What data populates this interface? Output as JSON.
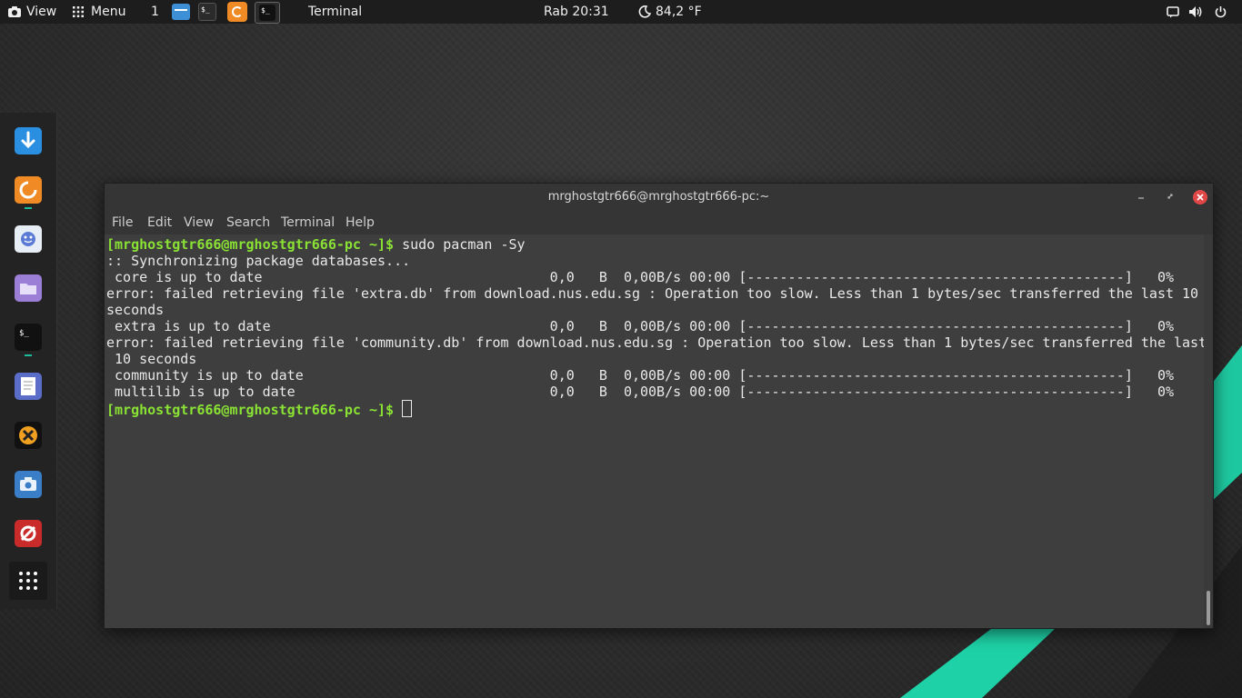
{
  "top_panel": {
    "view_label": "View",
    "menu_label": "Menu",
    "workspace": "1",
    "active_app": "Terminal",
    "clock": "Rab 20:31",
    "weather": "84,2 °F",
    "icons": [
      "camera-icon",
      "grid-icon",
      "file-manager-icon",
      "terminal-icon",
      "firefox-icon",
      "terminal-icon",
      "moon-icon",
      "chat-icon",
      "volume-icon",
      "power-icon"
    ]
  },
  "dock": {
    "items": [
      "download-icon",
      "firefox-icon",
      "pidgin-icon",
      "files-icon",
      "terminal-icon",
      "text-editor-icon",
      "xfce-settings-icon",
      "screenshot-icon",
      "rescue-icon",
      "app-grid-icon"
    ]
  },
  "window": {
    "title": "mrghostgtr666@mrghostgtr666-pc:~",
    "menu": [
      "File",
      "Edit",
      "View",
      "Search",
      "Terminal",
      "Help"
    ]
  },
  "terminal": {
    "prompt": "[mrghostgtr666@mrghostgtr666-pc ~]$",
    "command": " sudo pacman -Sy",
    "lines": [
      ":: Synchronizing package databases...",
      " core is up to date                                   0,0   B  0,00B/s 00:00 [----------------------------------------------]   0%",
      "error: failed retrieving file 'extra.db' from download.nus.edu.sg : Operation too slow. Less than 1 bytes/sec transferred the last 10",
      "seconds",
      " extra is up to date                                  0,0   B  0,00B/s 00:00 [----------------------------------------------]   0%",
      "error: failed retrieving file 'community.db' from download.nus.edu.sg : Operation too slow. Less than 1 bytes/sec transferred the last",
      " 10 seconds",
      " community is up to date                              0,0   B  0,00B/s 00:00 [----------------------------------------------]   0%",
      " multilib is up to date                               0,0   B  0,00B/s 00:00 [----------------------------------------------]   0%"
    ],
    "final_prompt": "[mrghostgtr666@mrghostgtr666-pc ~]$"
  },
  "colors": {
    "accent": "#1abc9c",
    "prompt": "#8ae234",
    "close": "#e04848"
  }
}
